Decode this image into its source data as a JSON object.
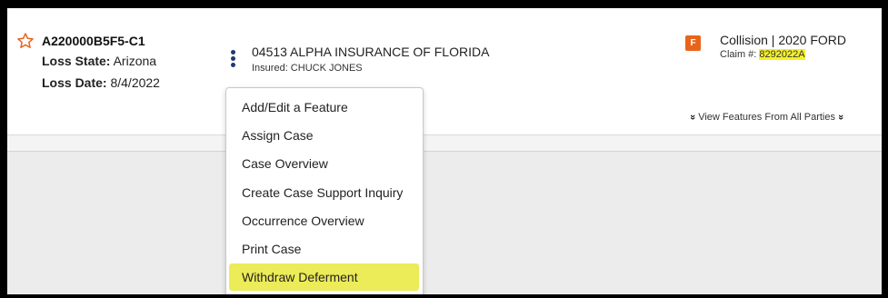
{
  "case": {
    "id": "A220000B5F5-C1",
    "loss_state_label": "Loss State:",
    "loss_state_value": "Arizona",
    "loss_date_label": "Loss Date:",
    "loss_date_value": "8/4/2022"
  },
  "policy": {
    "insurer": "04513 ALPHA INSURANCE OF FLORIDA",
    "insured": "Insured: CHUCK JONES"
  },
  "feature": {
    "badge": "F",
    "title": "Collision | 2020 FORD",
    "claim_label": "Claim #:",
    "claim_number": "8292022A",
    "view_all_label": "View Features From All Parties"
  },
  "menu": {
    "items": [
      {
        "label": "Add/Edit a Feature"
      },
      {
        "label": "Assign Case"
      },
      {
        "label": "Case Overview"
      },
      {
        "label": "Create Case Support Inquiry"
      },
      {
        "label": "Occurrence Overview"
      },
      {
        "label": "Print Case"
      },
      {
        "label": "Withdraw Deferment"
      }
    ],
    "highlighted_index": 6
  },
  "colors": {
    "badge": "#e8641b",
    "star": "#e8641b",
    "kebab": "#1c3a6e",
    "highlight": "#eceb58",
    "claim_highlight": "#f5f02a"
  },
  "icons": {
    "star": "star-outline-icon",
    "kebab": "kebab-menu-icon",
    "chevron": "double-chevron-down-icon"
  }
}
